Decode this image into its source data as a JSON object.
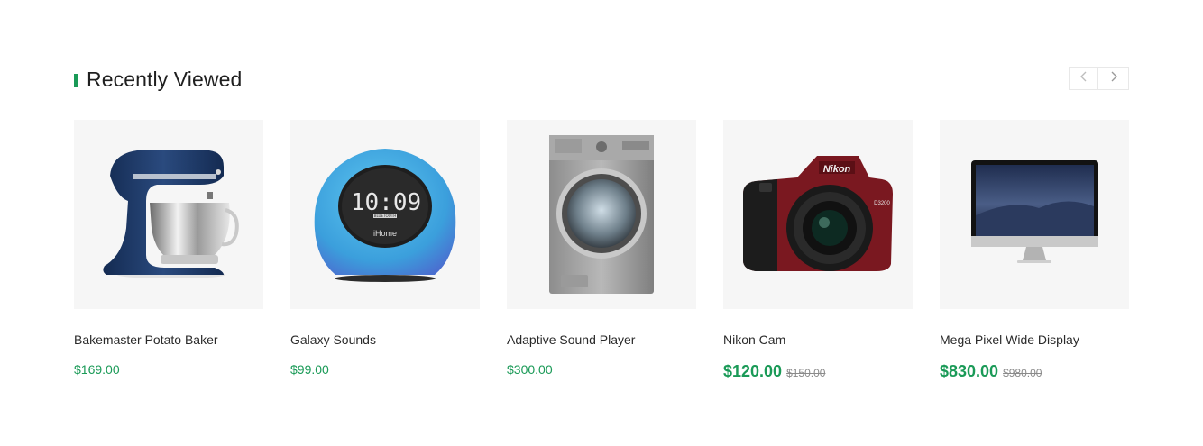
{
  "section": {
    "title": "Recently Viewed",
    "accent_color": "#1a9a57",
    "nav": {
      "prev_icon": "chevron-left-icon",
      "next_icon": "chevron-right-icon"
    }
  },
  "products": [
    {
      "name": "Bakemaster Potato Baker",
      "price": "$169.00",
      "old_price": "",
      "image": "stand-mixer"
    },
    {
      "name": "Galaxy Sounds",
      "price": "$99.00",
      "old_price": "",
      "image": "clock-speaker"
    },
    {
      "name": "Adaptive Sound Player",
      "price": "$300.00",
      "old_price": "",
      "image": "washing-machine"
    },
    {
      "name": "Nikon Cam",
      "price": "$120.00",
      "old_price": "$150.00",
      "image": "dslr-camera"
    },
    {
      "name": "Mega Pixel Wide Display",
      "price": "$830.00",
      "old_price": "$980.00",
      "image": "desktop-monitor"
    }
  ],
  "product_images": {
    "clock_speaker": {
      "time": "10:09",
      "brand": "iHome",
      "sub": "BLUETOOTH"
    },
    "camera": {
      "brand": "Nikon",
      "model": "D3200"
    }
  }
}
